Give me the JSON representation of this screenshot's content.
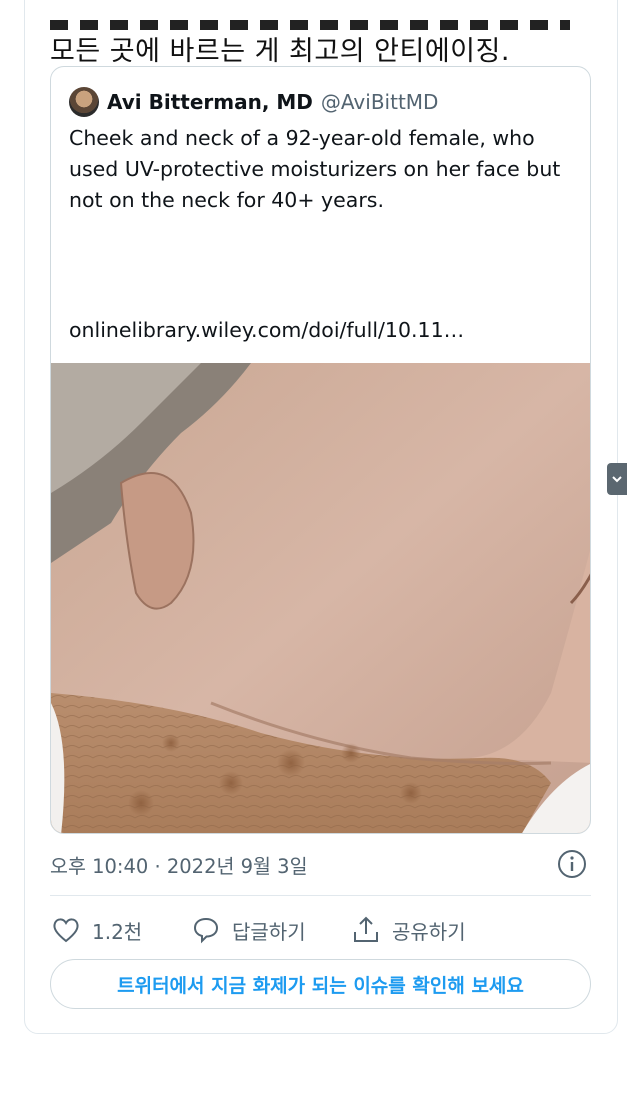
{
  "post": {
    "caption_line": "모든 곳에 바르는 게 최고의 안티에이징."
  },
  "quoted_tweet": {
    "author_name": "Avi Bitterman, MD",
    "author_handle": "@AviBittMD",
    "text": "Cheek and neck of a 92-year-old female, who used UV-protective moisturizers on her face but not on the neck for 40+ years.",
    "link": "onlinelibrary.wiley.com/doi/full/10.11…",
    "image_description_icon": "photo"
  },
  "meta": {
    "timestamp": "오후 10:40 · 2022년 9월 3일"
  },
  "actions": {
    "like_count": "1.2천",
    "reply_label": "답글하기",
    "share_label": "공유하기"
  },
  "cta": {
    "label": "트위터에서 지금 화제가 되는 이슈를 확인해 보세요"
  },
  "colors": {
    "accent": "#1d9bf0",
    "muted": "#536471",
    "border": "#cfd9de"
  }
}
